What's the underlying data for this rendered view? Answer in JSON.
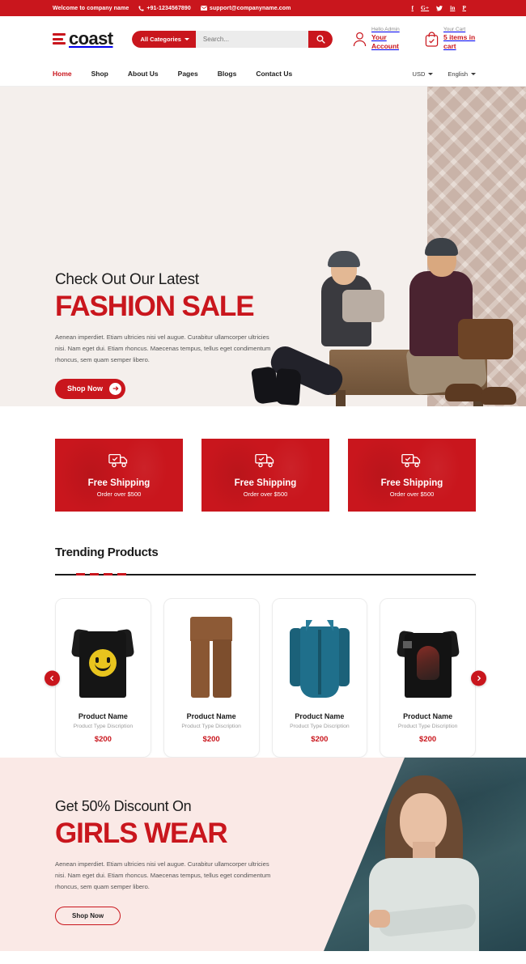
{
  "topbar": {
    "welcome": "Welcome to company name",
    "phone": "+91-1234567890",
    "email": "support@companyname.com",
    "socials": [
      {
        "name": "facebook-icon",
        "glyph": "f"
      },
      {
        "name": "google-plus-icon",
        "glyph": "G+"
      },
      {
        "name": "twitter-icon",
        "glyph": "t"
      },
      {
        "name": "linkedin-icon",
        "glyph": "in"
      },
      {
        "name": "pinterest-icon",
        "glyph": "P"
      }
    ]
  },
  "header": {
    "logo_text": "coast",
    "category_label": "All Categories",
    "search_placeholder": "Search...",
    "search_value": "",
    "account": {
      "top": "Hello Admin",
      "bottom": "Your Account"
    },
    "cart": {
      "top": "Your Cart",
      "bottom": "5 items in cart"
    }
  },
  "nav": {
    "links": [
      {
        "label": "Home",
        "active": true
      },
      {
        "label": "Shop",
        "active": false
      },
      {
        "label": "About Us",
        "active": false
      },
      {
        "label": "Pages",
        "active": false
      },
      {
        "label": "Blogs",
        "active": false
      },
      {
        "label": "Contact Us",
        "active": false
      }
    ],
    "currency": "USD",
    "language": "English"
  },
  "hero": {
    "subtitle": "Check Out Our Latest",
    "title": "FASHION SALE",
    "description": "Aenean imperdiet. Etiam ultricies nisi vel augue. Curabitur ullamcorper ultricies nisi. Nam eget dui. Etiam rhoncus. Maecenas tempus, tellus eget condimentum rhoncus, sem quam semper libero.",
    "button": "Shop Now"
  },
  "shipping": [
    {
      "title": "Free Shipping",
      "subtitle": "Order over $500"
    },
    {
      "title": "Free Shipping",
      "subtitle": "Order over $500"
    },
    {
      "title": "Free Shipping",
      "subtitle": "Order over $500"
    }
  ],
  "trending": {
    "title": "Trending Products",
    "products": [
      {
        "name": "Product Name",
        "type": "Product Type Discription",
        "price": "$200",
        "art": "tshirt-black"
      },
      {
        "name": "Product Name",
        "type": "Product Type Discription",
        "price": "$200",
        "art": "pants"
      },
      {
        "name": "Product Name",
        "type": "Product Type Discription",
        "price": "$200",
        "art": "shirt-blue"
      },
      {
        "name": "Product Name",
        "type": "Product Type Discription",
        "price": "$200",
        "art": "tshirt-flag"
      }
    ]
  },
  "promo": {
    "subtitle": "Get 50% Discount On",
    "title": "GIRLS WEAR",
    "description": "Aenean imperdiet. Etiam ultricies nisi vel augue. Curabitur ullamcorper ultricies nisi. Nam eget dui. Etiam rhoncus. Maecenas tempus, tellus eget condimentum rhoncus, sem quam semper libero.",
    "button": "Shop Now"
  },
  "colors": {
    "brand_red": "#c9161d",
    "hero_bg": "#f4efec",
    "promo_bg": "#fae9e6",
    "dark_text": "#1a1a1a"
  }
}
